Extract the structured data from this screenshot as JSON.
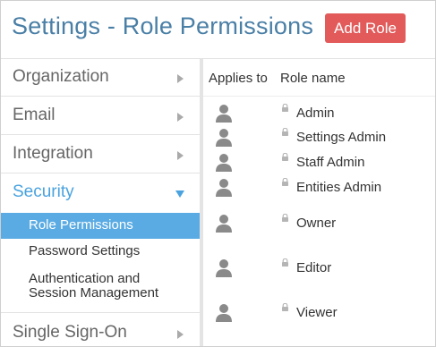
{
  "header": {
    "title": "Settings - Role Permissions",
    "add_role_label": "Add Role"
  },
  "colors": {
    "title": "#4a7fa6",
    "add_button": "#e25a5a",
    "active": "#4aa3df",
    "selected_bg": "#5aabe3"
  },
  "sidebar": {
    "items": [
      {
        "label": "Organization"
      },
      {
        "label": "Email"
      },
      {
        "label": "Integration"
      },
      {
        "label": "Security",
        "expanded": true
      },
      {
        "label": "Single Sign-On"
      }
    ],
    "security_sub": [
      {
        "label": "Role Permissions",
        "selected": true
      },
      {
        "label": "Password Settings"
      },
      {
        "label": "Authentication and Session Management"
      }
    ]
  },
  "table": {
    "columns": [
      "Applies to",
      "Role name"
    ],
    "roles": [
      {
        "name": "Admin",
        "icon": "person-icon",
        "lock": "lock-icon"
      },
      {
        "name": "Settings Admin",
        "icon": "person-icon",
        "lock": "lock-icon"
      },
      {
        "name": "Staff Admin",
        "icon": "person-icon",
        "lock": "lock-icon"
      },
      {
        "name": "Entities Admin",
        "icon": "person-icon",
        "lock": "lock-icon"
      },
      {
        "name": "Owner",
        "icon": "person-icon",
        "lock": "lock-icon"
      },
      {
        "name": "Editor",
        "icon": "person-icon",
        "lock": "lock-icon"
      },
      {
        "name": "Viewer",
        "icon": "person-icon",
        "lock": "lock-icon"
      }
    ]
  }
}
